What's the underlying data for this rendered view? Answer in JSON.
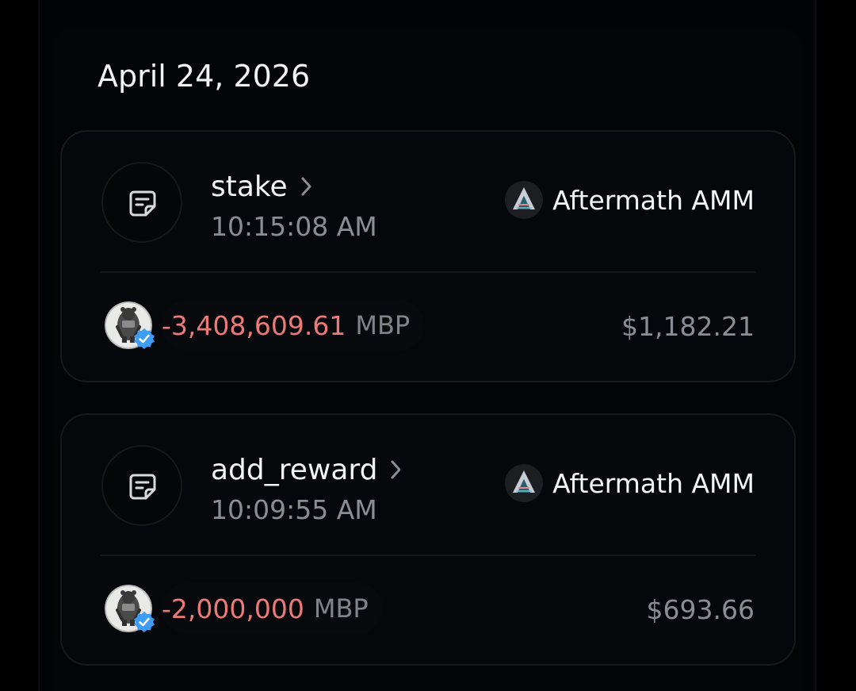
{
  "date_header": "April 24, 2026",
  "transactions": [
    {
      "function_name": "stake",
      "time": "10:15:08 AM",
      "protocol_name": "Aftermath AMM",
      "amount": "-3,408,609.61",
      "token_symbol": "MBP",
      "usd_value": "$1,182.21",
      "icons": {
        "function": "note-icon",
        "chevron": "chevron-right-icon",
        "protocol": "aftermath-logo-icon",
        "token": "mbp-token-icon",
        "verified": "verified-badge-icon"
      }
    },
    {
      "function_name": "add_reward",
      "time": "10:09:55 AM",
      "protocol_name": "Aftermath AMM",
      "amount": "-2,000,000",
      "token_symbol": "MBP",
      "usd_value": "$693.66",
      "icons": {
        "function": "note-icon",
        "chevron": "chevron-right-icon",
        "protocol": "aftermath-logo-icon",
        "token": "mbp-token-icon",
        "verified": "verified-badge-icon"
      }
    }
  ],
  "colors": {
    "background": "#000000",
    "card_background": "#05070a",
    "card_border": "#17191c",
    "negative_amount": "#ec7a78",
    "muted_text": "#8a8d93",
    "primary_text": "#f4f5f7",
    "verified_blue": "#3d9df5"
  }
}
